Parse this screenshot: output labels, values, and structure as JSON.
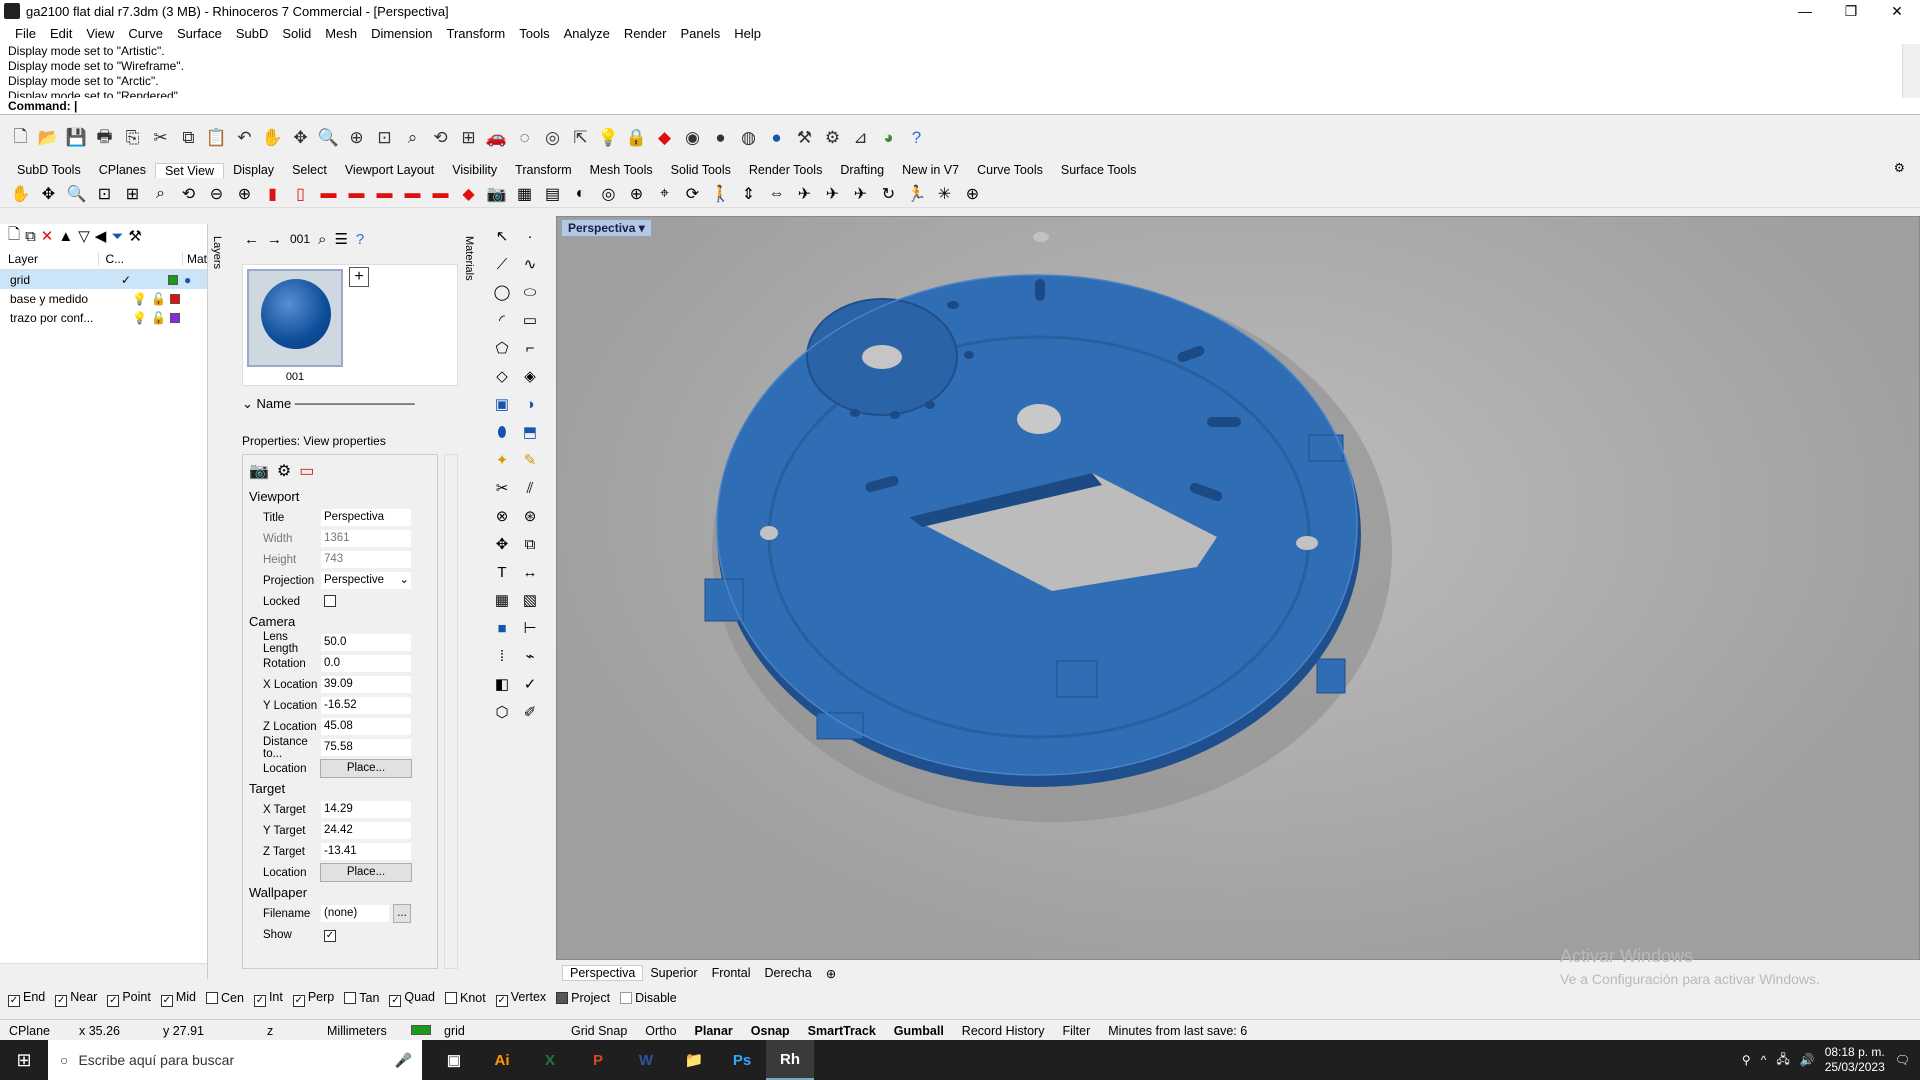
{
  "window": {
    "title": "ga2100 flat dial r7.3dm (3 MB) - Rhinoceros 7 Commercial - [Perspectiva]"
  },
  "menu": [
    "File",
    "Edit",
    "View",
    "Curve",
    "Surface",
    "SubD",
    "Solid",
    "Mesh",
    "Dimension",
    "Transform",
    "Tools",
    "Analyze",
    "Render",
    "Panels",
    "Help"
  ],
  "command_history": [
    "Display mode set to \"Artistic\".",
    "Display mode set to \"Wireframe\".",
    "Display mode set to \"Arctic\".",
    "Display mode set to \"Rendered\"."
  ],
  "command_prompt": "Command:",
  "toolbar_tabs": [
    "SubD Tools",
    "CPlanes",
    "Set View",
    "Display",
    "Select",
    "Viewport Layout",
    "Visibility",
    "Transform",
    "Mesh Tools",
    "Solid Tools",
    "Render Tools",
    "Drafting",
    "New in V7",
    "Curve Tools",
    "Surface Tools"
  ],
  "active_toolbar_tab": "Set View",
  "layers": {
    "columns": [
      "Layer",
      "C...",
      "Mat"
    ],
    "rows": [
      {
        "name": "grid",
        "current": "✓",
        "color": "#1a9a1a"
      },
      {
        "name": "base y medido",
        "current": "",
        "color": "#e01010"
      },
      {
        "name": "trazo por conf...",
        "current": "",
        "color": "#8a2be2"
      }
    ],
    "side_tab": "Layers"
  },
  "named_views": {
    "current": "001",
    "thumb_label": "001",
    "sort_label": "Name",
    "side_tab": "Materials"
  },
  "properties": {
    "title": "Properties: View properties",
    "viewport_section": "Viewport",
    "viewport": [
      {
        "k": "Title",
        "v": "Perspectiva"
      },
      {
        "k": "Width",
        "v": "1361"
      },
      {
        "k": "Height",
        "v": "743"
      },
      {
        "k": "Projection",
        "v": "Perspective"
      },
      {
        "k": "Locked",
        "v": ""
      }
    ],
    "camera_section": "Camera",
    "camera": [
      {
        "k": "Lens Length",
        "v": "50.0"
      },
      {
        "k": "Rotation",
        "v": "0.0"
      },
      {
        "k": "X Location",
        "v": "39.09"
      },
      {
        "k": "Y Location",
        "v": "-16.52"
      },
      {
        "k": "Z Location",
        "v": "45.08"
      },
      {
        "k": "Distance to...",
        "v": "75.58"
      },
      {
        "k": "Location",
        "v": "Place..."
      }
    ],
    "target_section": "Target",
    "target": [
      {
        "k": "X Target",
        "v": "14.29"
      },
      {
        "k": "Y Target",
        "v": "24.42"
      },
      {
        "k": "Z Target",
        "v": "-13.41"
      },
      {
        "k": "Location",
        "v": "Place..."
      }
    ],
    "wallpaper_section": "Wallpaper",
    "wallpaper": [
      {
        "k": "Filename",
        "v": "(none)"
      },
      {
        "k": "Show",
        "v": ""
      }
    ],
    "browse_label": "..."
  },
  "viewport": {
    "label": "Perspectiva",
    "tabs": [
      "Perspectiva",
      "Superior",
      "Frontal",
      "Derecha"
    ],
    "active_tab": "Perspectiva",
    "part_color": "#2f6db5",
    "background_color": "#a8a8a8"
  },
  "watermark": {
    "line1": "Activar Windows",
    "line2": "Ve a Configuración para activar Windows."
  },
  "osnaps": [
    {
      "label": "End",
      "checked": true
    },
    {
      "label": "Near",
      "checked": true
    },
    {
      "label": "Point",
      "checked": true
    },
    {
      "label": "Mid",
      "checked": true
    },
    {
      "label": "Cen",
      "checked": false
    },
    {
      "label": "Int",
      "checked": true
    },
    {
      "label": "Perp",
      "checked": true
    },
    {
      "label": "Tan",
      "checked": false
    },
    {
      "label": "Quad",
      "checked": true
    },
    {
      "label": "Knot",
      "checked": false
    },
    {
      "label": "Vertex",
      "checked": true
    },
    {
      "label": "Project",
      "checked": true
    },
    {
      "label": "Disable",
      "checked": false
    }
  ],
  "status": {
    "cplane": "CPlane",
    "x": "x 35.26",
    "y": "y 27.91",
    "z": "z",
    "units": "Millimeters",
    "layer": "grid",
    "grid_snap": "Grid Snap",
    "ortho": "Ortho",
    "planar": "Planar",
    "osnap": "Osnap",
    "smarttrack": "SmartTrack",
    "gumball": "Gumball",
    "record_history": "Record History",
    "filter": "Filter",
    "last_save": "Minutes from last save: 6"
  },
  "taskbar": {
    "search_placeholder": "Escribe aquí para buscar",
    "time": "08:18 p. m.",
    "date": "25/03/2023",
    "apps": [
      "Ai",
      "X",
      "P",
      "W",
      "📁",
      "Ps",
      "Rh"
    ]
  }
}
